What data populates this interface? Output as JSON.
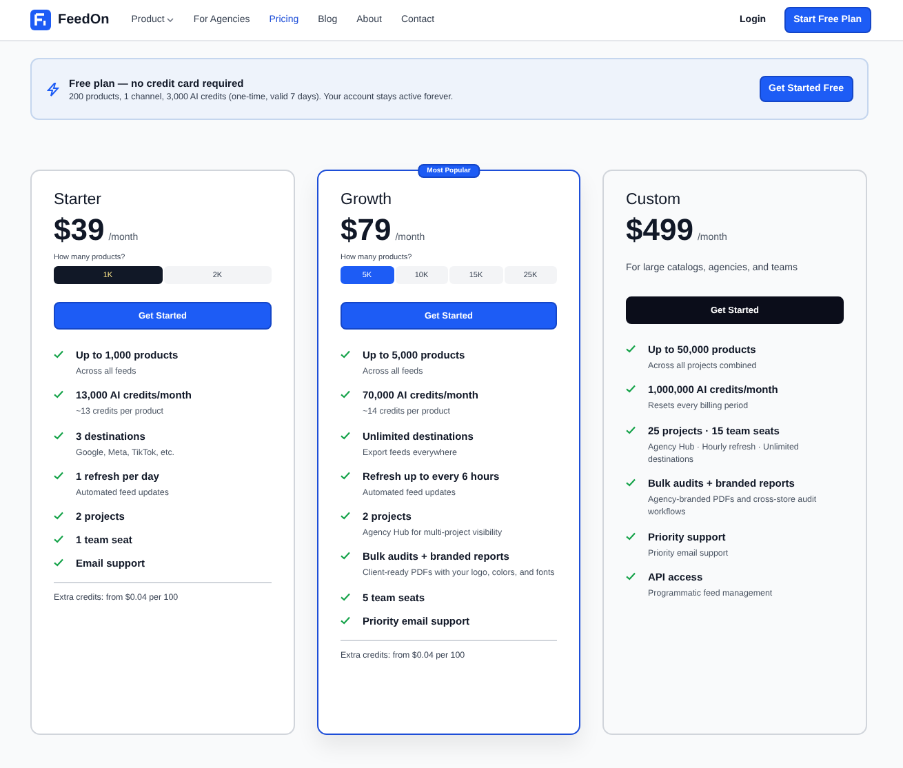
{
  "header": {
    "logo": "FeedOn",
    "nav": [
      {
        "label": "Product",
        "selected": false,
        "has_menu": true
      },
      {
        "label": "For Agencies",
        "selected": false,
        "has_menu": false
      },
      {
        "label": "Pricing",
        "selected": true,
        "has_menu": false
      },
      {
        "label": "Blog",
        "selected": false,
        "has_menu": false
      },
      {
        "label": "About",
        "selected": false,
        "has_menu": false
      },
      {
        "label": "Contact",
        "selected": false,
        "has_menu": false
      }
    ],
    "login": "Login",
    "cta": "Start Free Plan"
  },
  "banner": {
    "title": "Free plan — no credit card required",
    "text": "200 products, 1 channel, 3,000 AI credits (one-time, valid 7 days). Your account stays active forever.",
    "button": "Get Started Free"
  },
  "plans": [
    {
      "name": "Starter",
      "price": "$39",
      "period": "/month",
      "highlighted": false,
      "selector_label": "How many products?",
      "options": [
        {
          "label": "1K",
          "selected": true,
          "kind": "dark"
        },
        {
          "label": "2K",
          "selected": false,
          "kind": "dark"
        }
      ],
      "button": {
        "label": "Get Started",
        "kind": "primary"
      },
      "features": [
        {
          "title": "Up to 1,000 products",
          "detail": "Across all feeds"
        },
        {
          "title": "13,000 AI credits/month",
          "detail": "~13 credits per product"
        },
        {
          "title": "3 destinations",
          "detail": "Google, Meta, TikTok, etc."
        },
        {
          "title": "1 refresh per day",
          "detail": "Automated feed updates"
        },
        {
          "title": "2 projects"
        },
        {
          "title": "1 team seat"
        },
        {
          "title": "Email support"
        }
      ],
      "footnote": "Extra credits: from $0.04 per 100"
    },
    {
      "name": "Growth",
      "price": "$79",
      "period": "/month",
      "highlighted": true,
      "badge": "Most Popular",
      "selector_label": "How many products?",
      "options": [
        {
          "label": "5K",
          "selected": true,
          "kind": "blue"
        },
        {
          "label": "10K",
          "selected": false,
          "kind": "blue"
        },
        {
          "label": "15K",
          "selected": false,
          "kind": "blue"
        },
        {
          "label": "25K",
          "selected": false,
          "kind": "blue"
        }
      ],
      "button": {
        "label": "Get Started",
        "kind": "primary"
      },
      "features": [
        {
          "title": "Up to 5,000 products",
          "detail": "Across all feeds"
        },
        {
          "title": "70,000 AI credits/month",
          "detail": "~14 credits per product"
        },
        {
          "title": "Unlimited destinations",
          "detail": "Export feeds everywhere"
        },
        {
          "title": "Refresh up to every 6 hours",
          "detail": "Automated feed updates"
        },
        {
          "title": "2 projects",
          "detail": "Agency Hub for multi-project visibility"
        },
        {
          "title": "Bulk audits + branded reports",
          "detail": "Client-ready PDFs with your logo, colors, and fonts"
        },
        {
          "title": "5 team seats"
        },
        {
          "title": "Priority email support"
        }
      ],
      "footnote": "Extra credits: from $0.04 per 100"
    },
    {
      "name": "Custom",
      "price": "$499",
      "period": "/month",
      "highlighted": false,
      "description": "For large catalogs, agencies, and teams",
      "button": {
        "label": "Get Started",
        "kind": "dark"
      },
      "features": [
        {
          "title": "Up to 50,000 products",
          "detail": "Across all projects combined"
        },
        {
          "title": "1,000,000 AI credits/month",
          "detail": "Resets every billing period"
        },
        {
          "title": "25 projects · 15 team seats",
          "detail": "Agency Hub · Hourly refresh · Unlimited destinations"
        },
        {
          "title": "Bulk audits + branded reports",
          "detail": "Agency-branded PDFs and cross-store audit workflows"
        },
        {
          "title": "Priority support",
          "detail": "Priority email support"
        },
        {
          "title": "API access",
          "detail": "Programmatic feed management"
        }
      ]
    }
  ]
}
